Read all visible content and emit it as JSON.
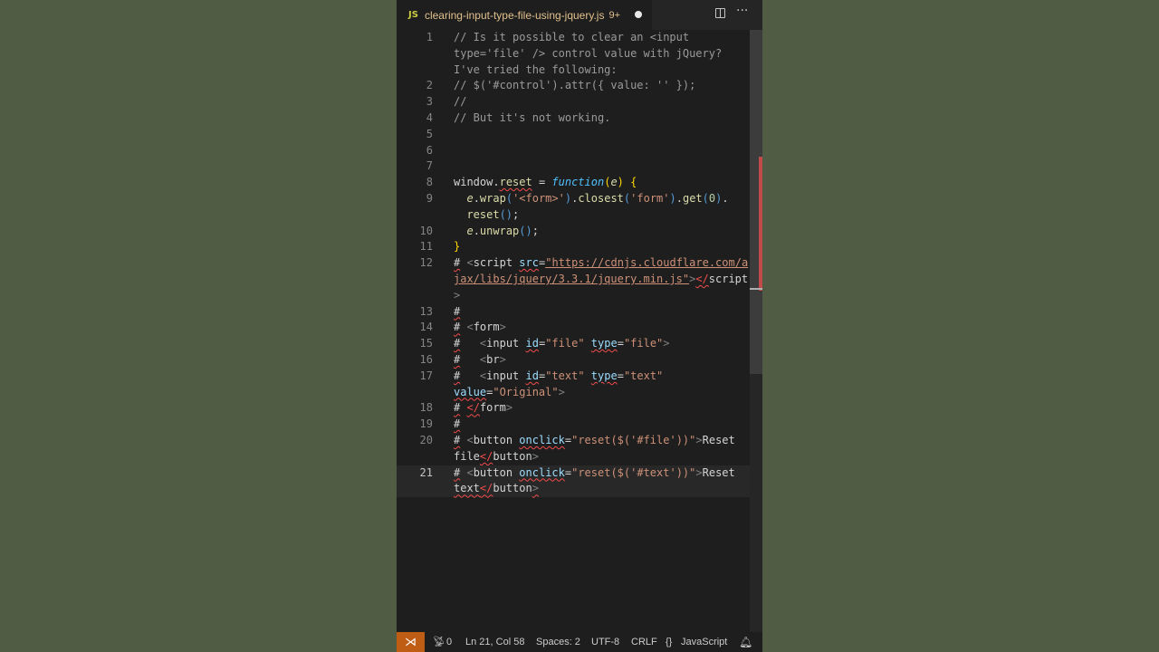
{
  "tab": {
    "lang_icon": "JS",
    "title": "clearing-input-type-file-using-jquery.js",
    "problems_badge": "9+"
  },
  "icons": {
    "split": "split-editor-icon",
    "more": "more-actions-icon",
    "remote": "remote-icon",
    "ports": "ports-icon",
    "braces": "braces-icon",
    "bell": "bell-icon"
  },
  "lines": [
    {
      "n": "1",
      "rows": 3
    },
    {
      "n": "2"
    },
    {
      "n": "3"
    },
    {
      "n": "4"
    },
    {
      "n": "5"
    },
    {
      "n": "6"
    },
    {
      "n": "7"
    },
    {
      "n": "8"
    },
    {
      "n": "9",
      "rows": 2
    },
    {
      "n": "10"
    },
    {
      "n": "11"
    },
    {
      "n": "12",
      "rows": 3
    },
    {
      "n": "13"
    },
    {
      "n": "14"
    },
    {
      "n": "15"
    },
    {
      "n": "16"
    },
    {
      "n": "17",
      "rows": 2
    },
    {
      "n": "18"
    },
    {
      "n": "19"
    },
    {
      "n": "20",
      "rows": 2
    },
    {
      "n": "21",
      "rows": 2
    }
  ],
  "code": {
    "l1a": "// Is it possible to clear an <input",
    "l1b": "type='file' /> control value with jQuery?",
    "l1c": "I've tried the following:",
    "l2": "// $('#control').attr({ value: '' });",
    "l3": "//",
    "l4": "// But it's not working.",
    "window": "window",
    "reset": "reset",
    "function": "function",
    "e": "e",
    "wrap": "wrap",
    "form_str": "'<form>'",
    "closest": "closest",
    "form_q": "'form'",
    "get": "get",
    "zero": "0",
    "reset2": "reset",
    "unwrap": "unwrap",
    "hash": "#",
    "script": "script",
    "src": "src",
    "url": "\"https://cdnjs.cloudflare.com/ajax/libs/jquery/3.3.1/jquery.min.js\"",
    "form": "form",
    "input": "input",
    "id": "id",
    "type": "type",
    "value": "value",
    "file_q": "\"file\"",
    "text_q": "\"text\"",
    "original_q": "\"Original\"",
    "br": "br",
    "button": "button",
    "onclick": "onclick",
    "onclick_file": "\"reset($('#file'))\"",
    "onclick_text": "\"reset($('#text'))\"",
    "reset_file_a": "Reset",
    "reset_file_b": "file",
    "reset_text_a": "Reset",
    "reset_text_b": "text"
  },
  "status": {
    "remote": "⊘",
    "ports_count": "0",
    "position": "Ln 21, Col 58",
    "spaces": "Spaces: 2",
    "encoding": "UTF-8",
    "eol": "CRLF",
    "language": "JavaScript"
  }
}
